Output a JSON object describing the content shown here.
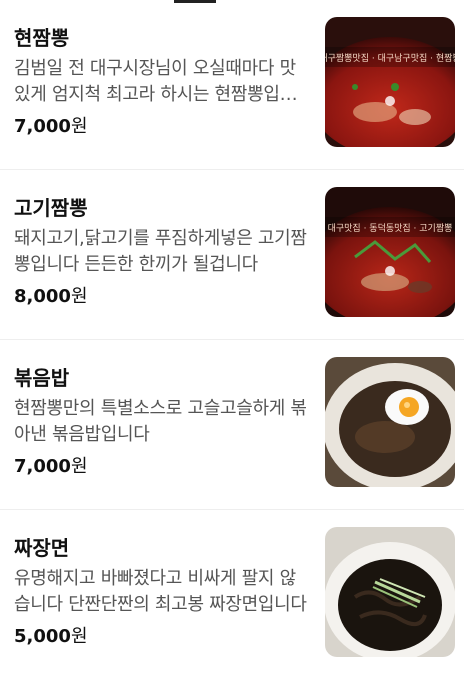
{
  "menu": [
    {
      "name": "현짬뽕",
      "description": "김범일 전 대구시장님이 오실때마다 맛있게 엄지척 최고라 하시는 현짬뽕입니다",
      "price": "7,000",
      "currency": "원",
      "image_icon": "jjamppong-photo-icon",
      "image_caption": "대구짬뽕맛집 · 대구남구맛집 · 현짬뽕"
    },
    {
      "name": "고기짬뽕",
      "description": "돼지고기,닭고기를 푸짐하게넣은 고기짬뽕입니다 든든한 한끼가 될겁니다",
      "price": "8,000",
      "currency": "원",
      "image_icon": "meat-jjamppong-photo-icon",
      "image_caption": "대구맛집 · 동덕동맛집 · 고기짬뽕"
    },
    {
      "name": "볶음밥",
      "description": "현짬뽕만의 특별소스로 고슬고슬하게 볶아낸 볶음밥입니다",
      "price": "7,000",
      "currency": "원",
      "image_icon": "fried-rice-photo-icon",
      "image_caption": ""
    },
    {
      "name": "짜장면",
      "description": "유명해지고 바빠졌다고 비싸게 팔지 않습니다 단짠단짠의 최고봉 짜장면입니다",
      "price": "5,000",
      "currency": "원",
      "image_icon": "jajangmyeon-photo-icon",
      "image_caption": ""
    }
  ]
}
